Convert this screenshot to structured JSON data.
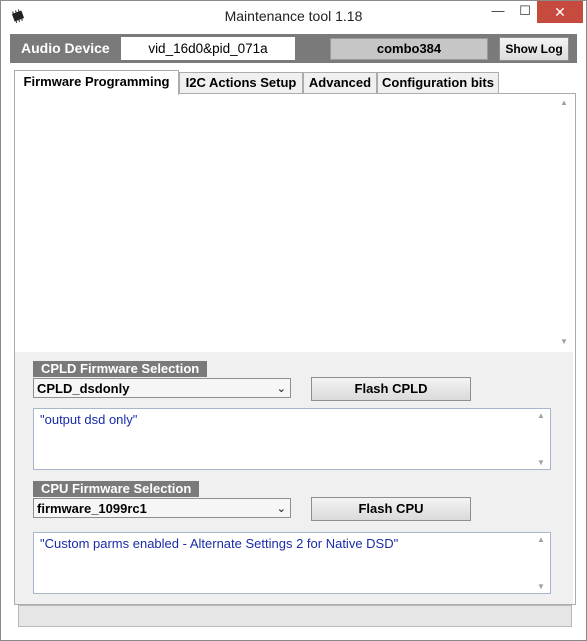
{
  "window": {
    "title": "Maintenance tool 1.18"
  },
  "device_bar": {
    "label": "Audio Device",
    "device_id": "vid_16d0&pid_071a",
    "combo": "combo384",
    "show_log": "Show Log"
  },
  "tabs": [
    {
      "label": "Firmware Programming",
      "active": true
    },
    {
      "label": "I2C Actions Setup",
      "active": false
    },
    {
      "label": "Advanced",
      "active": false
    },
    {
      "label": "Configuration bits",
      "active": false
    }
  ],
  "cpld": {
    "header": "CPLD Firmware Selection",
    "selected": "CPLD_dsdonly",
    "flash_label": "Flash CPLD",
    "description": "\"output dsd only\""
  },
  "cpu": {
    "header": "CPU Firmware Selection",
    "selected": "firmware_1099rc1",
    "flash_label": "Flash CPU",
    "description": "\"Custom parms enabled - Alternate Settings 2 for Native DSD\""
  },
  "colors": {
    "header_bg": "#7a7a7a",
    "close_button": "#c74a3f",
    "description_text": "#1a2ca8"
  }
}
